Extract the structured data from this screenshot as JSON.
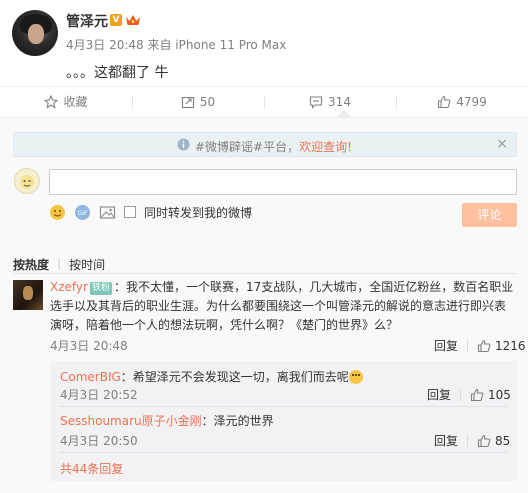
{
  "post": {
    "author": "管泽元",
    "verified_mark": "V",
    "meta": "4月3日 20:48 来自 iPhone 11 Pro Max",
    "text": "。。。这都翻了 牛"
  },
  "actions": [
    {
      "icon": "star-icon",
      "label": "收藏"
    },
    {
      "icon": "repost-icon",
      "label": "50"
    },
    {
      "icon": "comment-icon",
      "label": "314"
    },
    {
      "icon": "thumbs-up-icon",
      "label": "4799"
    }
  ],
  "notice": {
    "hashtag": "#微博辟谣#",
    "text": "平台，",
    "link": "欢迎查询!",
    "close": "×"
  },
  "compose": {
    "placeholder": "",
    "repost_label": "同时转发到我的微博",
    "submit_label": "评论"
  },
  "sort": {
    "active": "按热度",
    "separator": "|",
    "other": "按时间"
  },
  "comments": [
    {
      "user": "Xzefyr",
      "badge": "铁粉",
      "text": "：我不太懂，一个联赛，17支战队，几大城市，全国近亿粉丝，数百名职业选手以及其背后的职业生涯。为什么都要围绕这一个叫管泽元的解说的意志进行即兴表演呀，陪着他一个人的想法玩啊，凭什么啊？《楚门的世界》么？",
      "time": "4月3日 20:48",
      "reply_label": "回复",
      "likes": "1216",
      "replies": [
        {
          "user": "ComerBIG",
          "text": "：希望泽元不会发现这一切，离我们而去呢",
          "time": "4月3日 20:52",
          "reply_label": "回复",
          "likes": "105"
        },
        {
          "user": "Sesshoumaru原子小金刚",
          "text": "：泽元的世界",
          "time": "4月3日 20:50",
          "reply_label": "回复",
          "likes": "85"
        }
      ],
      "more_label": "共44条回复"
    }
  ],
  "colors": {
    "link": "#eb7350",
    "meta_gray": "#808080",
    "submit_bg": "#ffc09f",
    "notice_bg": "#eaf1f5"
  }
}
